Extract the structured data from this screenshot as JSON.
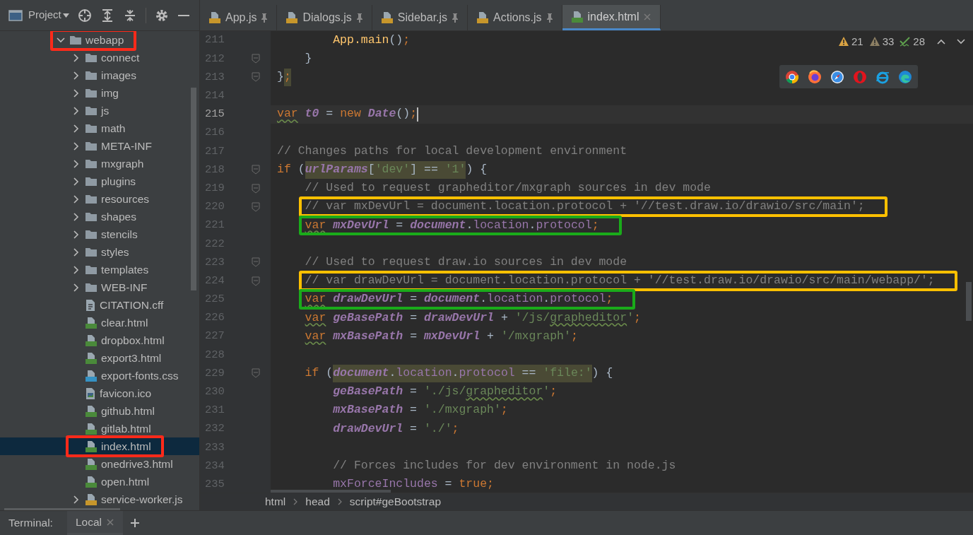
{
  "project_panel": {
    "title": "Project"
  },
  "tabs": [
    {
      "label": "App.js",
      "kind": "js",
      "pinned": true,
      "selected": false
    },
    {
      "label": "Dialogs.js",
      "kind": "js",
      "pinned": true,
      "selected": false
    },
    {
      "label": "Sidebar.js",
      "kind": "js",
      "pinned": true,
      "selected": false
    },
    {
      "label": "Actions.js",
      "kind": "js",
      "pinned": true,
      "selected": false
    },
    {
      "label": "index.html",
      "kind": "html",
      "pinned": false,
      "selected": true
    }
  ],
  "tree": [
    {
      "label": "webapp",
      "kind": "folder",
      "expanded": true,
      "selected": false,
      "box": {
        "color": "#ff2a1a"
      },
      "children": [
        {
          "label": "connect",
          "kind": "folder",
          "expanded": false,
          "selected": false
        },
        {
          "label": "images",
          "kind": "folder",
          "expanded": false,
          "selected": false
        },
        {
          "label": "img",
          "kind": "folder",
          "expanded": false,
          "selected": false
        },
        {
          "label": "js",
          "kind": "folder",
          "expanded": false,
          "selected": false
        },
        {
          "label": "math",
          "kind": "folder",
          "expanded": false,
          "selected": false
        },
        {
          "label": "META-INF",
          "kind": "folder",
          "expanded": false,
          "selected": false
        },
        {
          "label": "mxgraph",
          "kind": "folder",
          "expanded": false,
          "selected": false
        },
        {
          "label": "plugins",
          "kind": "folder",
          "expanded": false,
          "selected": false
        },
        {
          "label": "resources",
          "kind": "folder",
          "expanded": false,
          "selected": false
        },
        {
          "label": "shapes",
          "kind": "folder",
          "expanded": false,
          "selected": false
        },
        {
          "label": "stencils",
          "kind": "folder",
          "expanded": false,
          "selected": false
        },
        {
          "label": "styles",
          "kind": "folder",
          "expanded": false,
          "selected": false
        },
        {
          "label": "templates",
          "kind": "folder",
          "expanded": false,
          "selected": false
        },
        {
          "label": "WEB-INF",
          "kind": "folder",
          "expanded": false,
          "selected": false
        },
        {
          "label": "CITATION.cff",
          "kind": "text",
          "selected": false
        },
        {
          "label": "clear.html",
          "kind": "html",
          "selected": false
        },
        {
          "label": "dropbox.html",
          "kind": "html",
          "selected": false
        },
        {
          "label": "export3.html",
          "kind": "html",
          "selected": false
        },
        {
          "label": "export-fonts.css",
          "kind": "css",
          "selected": false
        },
        {
          "label": "favicon.ico",
          "kind": "image",
          "selected": false
        },
        {
          "label": "github.html",
          "kind": "html",
          "selected": false
        },
        {
          "label": "gitlab.html",
          "kind": "html",
          "selected": false
        },
        {
          "label": "index.html",
          "kind": "html",
          "selected": true,
          "box": {
            "color": "#ff2a1a"
          }
        },
        {
          "label": "onedrive3.html",
          "kind": "html",
          "selected": false
        },
        {
          "label": "open.html",
          "kind": "html",
          "selected": false
        },
        {
          "label": "service-worker.js",
          "kind": "binary",
          "expanded": false,
          "selected": false
        }
      ]
    }
  ],
  "inspections": [
    {
      "kind": "warning",
      "count": "21"
    },
    {
      "kind": "weak",
      "count": "33"
    },
    {
      "kind": "ok",
      "count": "28"
    }
  ],
  "browsers": [
    {
      "kind": "chrome"
    },
    {
      "kind": "firefox"
    },
    {
      "kind": "safari"
    },
    {
      "kind": "opera"
    },
    {
      "kind": "ie"
    },
    {
      "kind": "edge"
    }
  ],
  "code": [
    {
      "block": [
        {
          "block": [
            {
              "n": "211",
              "tokens": [
                {
                  "kind": "function",
                  "text": "App.main"
                },
                {
                  "kind": "plain",
                  "text": "()"
                },
                {
                  "kind": "keyword",
                  "text": ";"
                }
              ]
            }
          ]
        },
        {
          "n": "212",
          "fold": true,
          "tokens": [
            {
              "kind": "plain",
              "text": "}"
            }
          ]
        }
      ]
    },
    {
      "n": "213",
      "fold": true,
      "tokens": [
        {
          "kind": "plain",
          "text": "}"
        },
        {
          "kind": "keyword",
          "text": ";",
          "highlight": true
        }
      ]
    },
    {
      "n": "214"
    },
    {
      "n": "215",
      "current": true,
      "caret": true,
      "tokens": [
        {
          "kind": "keyword",
          "text": "var",
          "squiggle": true
        },
        {
          "kind": "variable",
          "text": " t0"
        },
        {
          "kind": "plain",
          "text": " = "
        },
        {
          "kind": "keyword",
          "text": "new"
        },
        {
          "kind": "variable",
          "text": " Date"
        },
        {
          "kind": "plain",
          "text": "()"
        },
        {
          "kind": "keyword",
          "text": ";"
        }
      ]
    },
    {
      "n": "216"
    },
    {
      "n": "217",
      "tokens": [
        {
          "kind": "comment",
          "text": "// Changes paths for local development environment"
        }
      ]
    },
    {
      "n": "218",
      "fold": true,
      "tokens": [
        {
          "kind": "keyword",
          "text": "if"
        },
        {
          "kind": "plain",
          "text": " ("
        },
        {
          "kind": "variable",
          "text": "urlParams",
          "highlight": true
        },
        {
          "kind": "plain",
          "text": "[",
          "highlight": true
        },
        {
          "kind": "string",
          "text": "'dev'",
          "highlight": true
        },
        {
          "kind": "plain",
          "text": "] == ",
          "highlight": true
        },
        {
          "kind": "string",
          "text": "'1'",
          "highlight": true
        },
        {
          "kind": "plain",
          "text": ") {"
        }
      ]
    },
    {
      "block": [
        {
          "n": "219",
          "fold": true,
          "tokens": [
            {
              "kind": "comment",
              "text": "// Used to request grapheditor/mxgraph sources in dev mode"
            }
          ]
        },
        {
          "n": "220",
          "fold": true,
          "box": {
            "color": "#ffc000"
          },
          "tokens": [
            {
              "kind": "comment",
              "text": "// var mxDevUrl = document.location.protocol + '//test.draw.io/drawio/src/main';"
            }
          ]
        },
        {
          "n": "221",
          "box": {
            "color": "#1aab1a"
          },
          "tokens": [
            {
              "kind": "keyword",
              "text": "var",
              "squiggle": true
            },
            {
              "kind": "variable",
              "text": " mxDevUrl"
            },
            {
              "kind": "plain",
              "text": " = "
            },
            {
              "kind": "variable",
              "text": "document"
            },
            {
              "kind": "plain",
              "text": "."
            },
            {
              "kind": "property",
              "text": "location"
            },
            {
              "kind": "plain",
              "text": "."
            },
            {
              "kind": "property",
              "text": "protocol"
            },
            {
              "kind": "keyword",
              "text": ";"
            }
          ]
        },
        {
          "n": "222"
        },
        {
          "n": "223",
          "fold": true,
          "tokens": [
            {
              "kind": "comment",
              "text": "// Used to request draw.io sources in dev mode"
            }
          ]
        },
        {
          "n": "224",
          "fold": true,
          "box": {
            "color": "#ffc000"
          },
          "tokens": [
            {
              "kind": "comment",
              "text": "// var drawDevUrl = document.location.protocol + '//test.draw.io/drawio/src/main/webapp/';"
            }
          ]
        },
        {
          "n": "225",
          "box": {
            "color": "#1aab1a"
          },
          "tokens": [
            {
              "kind": "keyword",
              "text": "var",
              "squiggle": true
            },
            {
              "kind": "variable",
              "text": " drawDevUrl"
            },
            {
              "kind": "plain",
              "text": " = "
            },
            {
              "kind": "variable",
              "text": "document"
            },
            {
              "kind": "plain",
              "text": "."
            },
            {
              "kind": "property",
              "text": "location"
            },
            {
              "kind": "plain",
              "text": "."
            },
            {
              "kind": "property",
              "text": "protocol"
            },
            {
              "kind": "keyword",
              "text": ";"
            }
          ]
        },
        {
          "n": "226",
          "tokens": [
            {
              "kind": "keyword",
              "text": "var",
              "squiggle": true
            },
            {
              "kind": "variable",
              "text": " geBasePath"
            },
            {
              "kind": "plain",
              "text": " = "
            },
            {
              "kind": "variable",
              "text": "drawDevUrl"
            },
            {
              "kind": "plain",
              "text": " + "
            },
            {
              "kind": "string",
              "text": "'/js/"
            },
            {
              "kind": "string",
              "text": "grapheditor",
              "squiggle": true
            },
            {
              "kind": "string",
              "text": "'"
            },
            {
              "kind": "keyword",
              "text": ";"
            }
          ]
        },
        {
          "n": "227",
          "tokens": [
            {
              "kind": "keyword",
              "text": "var",
              "squiggle": true
            },
            {
              "kind": "variable",
              "text": " mxBasePath"
            },
            {
              "kind": "plain",
              "text": " = "
            },
            {
              "kind": "variable",
              "text": "mxDevUrl"
            },
            {
              "kind": "plain",
              "text": " + "
            },
            {
              "kind": "string",
              "text": "'/mxgraph'"
            },
            {
              "kind": "keyword",
              "text": ";"
            }
          ]
        },
        {
          "n": "228"
        },
        {
          "n": "229",
          "fold": true,
          "tokens": [
            {
              "kind": "keyword",
              "text": "if"
            },
            {
              "kind": "plain",
              "text": " ("
            },
            {
              "kind": "variable",
              "text": "document",
              "highlight": true
            },
            {
              "kind": "plain",
              "text": ".",
              "highlight": true
            },
            {
              "kind": "property",
              "text": "location",
              "highlight": true
            },
            {
              "kind": "plain",
              "text": ".",
              "highlight": true
            },
            {
              "kind": "property",
              "text": "protocol",
              "highlight": true
            },
            {
              "kind": "plain",
              "text": " == ",
              "highlight": true
            },
            {
              "kind": "string",
              "text": "'file:'",
              "highlight": true
            },
            {
              "kind": "plain",
              "text": ") {"
            }
          ]
        },
        {
          "block": [
            {
              "n": "230",
              "tokens": [
                {
                  "kind": "variable",
                  "text": "geBasePath"
                },
                {
                  "kind": "plain",
                  "text": " = "
                },
                {
                  "kind": "string",
                  "text": "'./js/"
                },
                {
                  "kind": "string",
                  "text": "grapheditor",
                  "squiggle": true
                },
                {
                  "kind": "string",
                  "text": "'"
                },
                {
                  "kind": "keyword",
                  "text": ";"
                }
              ]
            },
            {
              "n": "231",
              "tokens": [
                {
                  "kind": "variable",
                  "text": "mxBasePath"
                },
                {
                  "kind": "plain",
                  "text": " = "
                },
                {
                  "kind": "string",
                  "text": "'./mxgraph'"
                },
                {
                  "kind": "keyword",
                  "text": ";"
                }
              ]
            },
            {
              "n": "232",
              "tokens": [
                {
                  "kind": "variable",
                  "text": "drawDevUrl"
                },
                {
                  "kind": "plain",
                  "text": " = "
                },
                {
                  "kind": "string",
                  "text": "'./'"
                },
                {
                  "kind": "keyword",
                  "text": ";"
                }
              ]
            },
            {
              "n": "233"
            },
            {
              "n": "234",
              "tokens": [
                {
                  "kind": "comment",
                  "text": "// Forces includes for dev environment in node.js"
                }
              ]
            },
            {
              "n": "235",
              "tokens": [
                {
                  "kind": "property",
                  "text": "mxForceIncludes"
                },
                {
                  "kind": "plain",
                  "text": " = "
                },
                {
                  "kind": "keyword",
                  "text": "true"
                },
                {
                  "kind": "keyword",
                  "text": ";"
                }
              ]
            }
          ]
        }
      ]
    }
  ],
  "breadcrumb": [
    "html",
    "head",
    "script#geBootstrap"
  ],
  "terminal": {
    "label": "Terminal:",
    "tabs": [
      {
        "label": "Local",
        "selected": true
      }
    ]
  }
}
